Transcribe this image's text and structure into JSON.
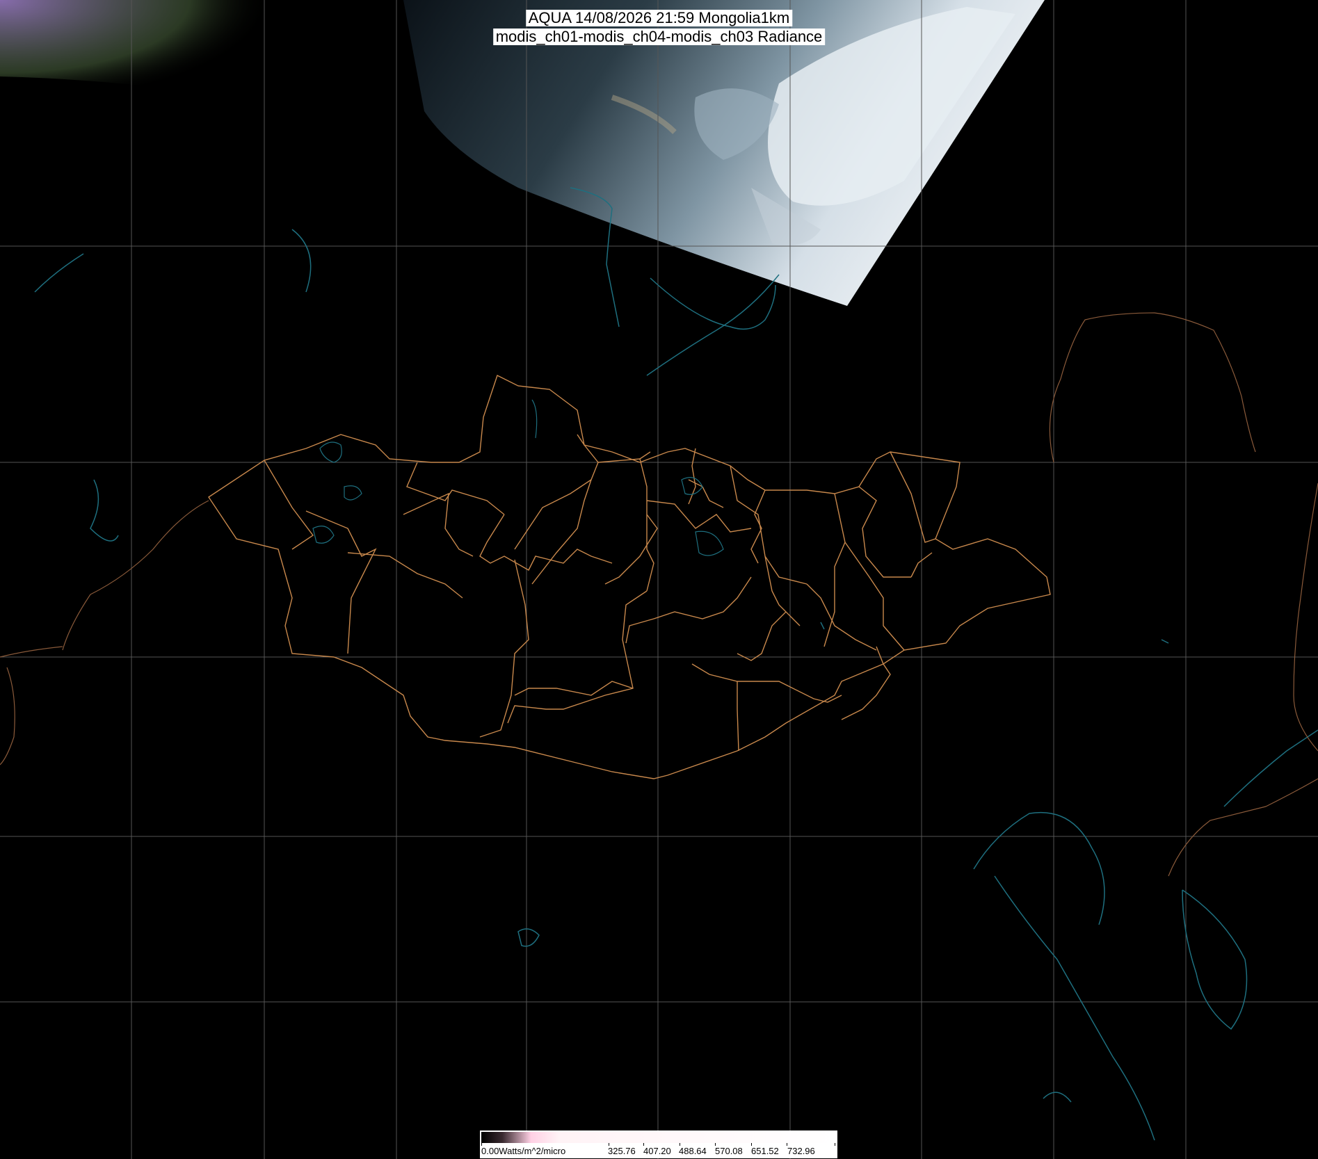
{
  "title": {
    "line1": "AQUA 14/08/2026 21:59 Mongolia1km",
    "line2": "modis_ch01-modis_ch04-modis_ch03 Radiance"
  },
  "colorbar": {
    "ramp_colors": [
      "#000000",
      "#3a2a30",
      "#ffd0e4",
      "#ffffff"
    ],
    "labels": [
      "0.00Watts/m^2/micro",
      "325.76",
      "407.20",
      "488.64",
      "570.08",
      "651.52",
      "732.96"
    ]
  },
  "colors": {
    "background": "#000000",
    "graticule": "#555555",
    "coastline": "#1e6f7f",
    "admin_boundary": "#c8884c",
    "country_boundary": "#8a5a3a",
    "cloud": "#d8e2ea",
    "swath_land": "#2c3e48"
  }
}
